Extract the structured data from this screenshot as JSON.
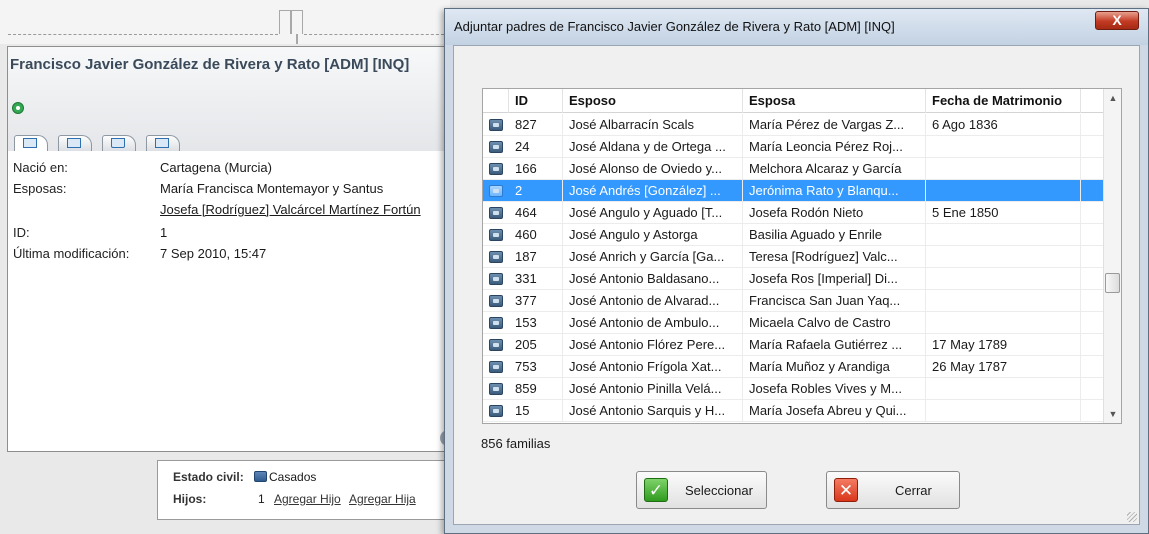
{
  "person": {
    "name": "Francisco Javier González de Rivera y Rato [ADM] [INQ]",
    "fields": [
      {
        "label": "Nació en:",
        "value": "Cartagena (Murcia)"
      },
      {
        "label": "Esposas:",
        "value": "María Francisca Montemayor y Santus",
        "value2": "Josefa [Rodríguez] Valcárcel Martínez Fortún"
      },
      {
        "label": "ID:",
        "value": "1"
      },
      {
        "label": "Última modificación:",
        "value": "7 Sep 2010, 15:47"
      }
    ],
    "tab_icons": [
      "person-card-icon",
      "family-sheet-icon",
      "home-icon",
      "picture-icon"
    ]
  },
  "family": {
    "civil_label": "Estado civil:",
    "civil_value": "Casados",
    "children_label": "Hijos:",
    "children_count": "1",
    "add_son": "Agregar Hijo",
    "add_daughter": "Agregar Hija"
  },
  "dialog": {
    "title": "Adjuntar padres de Francisco Javier González de Rivera y Rato [ADM] [INQ]",
    "close_glyph": "X",
    "columns": [
      "ID",
      "Esposo",
      "Esposa",
      "Fecha de Matrimonio"
    ],
    "rows": [
      {
        "id": "827",
        "esposo": "José Albarracín Scals",
        "esposa": "María Pérez de Vargas Z...",
        "fecha": "6 Ago 1836"
      },
      {
        "id": "24",
        "esposo": "José Aldana y de Ortega ...",
        "esposa": "María Leoncia Pérez Roj...",
        "fecha": ""
      },
      {
        "id": "166",
        "esposo": "José Alonso de Oviedo y...",
        "esposa": "Melchora Alcaraz y García",
        "fecha": ""
      },
      {
        "id": "2",
        "esposo": "José Andrés [González] ...",
        "esposa": "Jerónima Rato y Blanqu...",
        "fecha": "",
        "selected": true
      },
      {
        "id": "464",
        "esposo": "José Angulo y Aguado [T...",
        "esposa": "Josefa Rodón Nieto",
        "fecha": "5 Ene 1850"
      },
      {
        "id": "460",
        "esposo": "José Angulo y Astorga",
        "esposa": "Basilia Aguado y Enrile",
        "fecha": ""
      },
      {
        "id": "187",
        "esposo": "José Anrich y García [Ga...",
        "esposa": "Teresa [Rodríguez] Valc...",
        "fecha": ""
      },
      {
        "id": "331",
        "esposo": "José Antonio Baldasano...",
        "esposa": "Josefa Ros [Imperial] Di...",
        "fecha": ""
      },
      {
        "id": "377",
        "esposo": "José Antonio de Alvarad...",
        "esposa": "Francisca San Juan Yaq...",
        "fecha": ""
      },
      {
        "id": "153",
        "esposo": "José Antonio de Ambulo...",
        "esposa": "Micaela Calvo de Castro",
        "fecha": ""
      },
      {
        "id": "205",
        "esposo": "José Antonio Flórez Pere...",
        "esposa": "María Rafaela Gutiérrez ...",
        "fecha": "17 May 1789"
      },
      {
        "id": "753",
        "esposo": "José Antonio Frígola Xat...",
        "esposa": "María Muñoz y Arandiga",
        "fecha": "26 May 1787"
      },
      {
        "id": "859",
        "esposo": "José Antonio Pinilla Velá...",
        "esposa": "Josefa Robles Vives y M...",
        "fecha": ""
      },
      {
        "id": "15",
        "esposo": "José Antonio Sarquis y H...",
        "esposa": "María Josefa Abreu y Qui...",
        "fecha": ""
      }
    ],
    "count_label": "856 familias",
    "select_button": "Seleccionar",
    "close_button": "Cerrar"
  },
  "colors": {
    "selection": "#3399ff",
    "ok_icon": "#2f9a1e",
    "cancel_icon": "#d9361b",
    "close_button": "#c23a22"
  }
}
